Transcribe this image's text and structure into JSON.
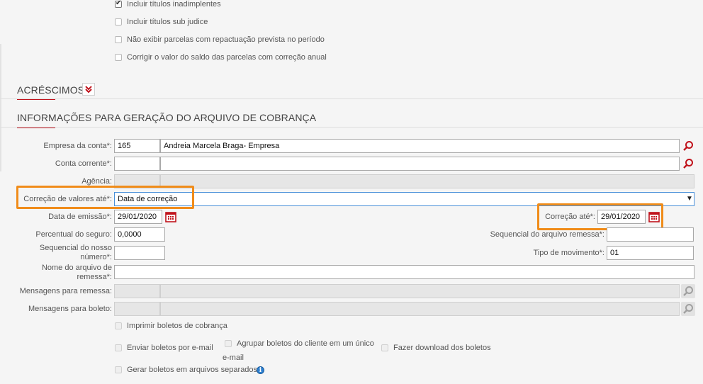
{
  "top_options": [
    {
      "label": "Incluir títulos inadimplentes",
      "checked": true
    },
    {
      "label": "Incluir títulos sub judice",
      "checked": false
    },
    {
      "label": "Não exibir parcelas com repactuação prevista no período",
      "checked": false
    },
    {
      "label": "Corrigir o valor do saldo das parcelas com correção anual",
      "checked": false
    }
  ],
  "sections": {
    "acrescimos": "ACRÉSCIMOS",
    "info": "INFORMAÇÕES PARA GERAÇÃO DO ARQUIVO DE COBRANÇA"
  },
  "form": {
    "empresa": {
      "label": "Empresa da conta*:",
      "code": "165",
      "name": "Andreia Marcela Braga- Empresa"
    },
    "conta": {
      "label": "Conta corrente*:",
      "code": "",
      "name": ""
    },
    "agencia": {
      "label": "Agência:",
      "code": "",
      "name": ""
    },
    "correcao_valores": {
      "label": "Correção de valores até*:",
      "value": "Data de correção"
    },
    "data_emissao": {
      "label": "Data de emissão*:",
      "value": "29/01/2020"
    },
    "correcao_ate": {
      "label": "Correção até*:",
      "value": "29/01/2020"
    },
    "percentual": {
      "label": "Percentual do seguro:",
      "value": "0,0000"
    },
    "seq_remessa": {
      "label": "Sequencial do arquivo remessa*:",
      "value": ""
    },
    "seq_nosso": {
      "label_1": "Sequencial do nosso",
      "label_2": "número*:",
      "value": ""
    },
    "tipo_mov": {
      "label": "Tipo de movimento*:",
      "value": "01"
    },
    "nome_arquivo": {
      "label_1": "Nome do arquivo de",
      "label_2": "remessa*:",
      "value": ""
    },
    "msg_remessa": {
      "label": "Mensagens para remessa:"
    },
    "msg_boleto": {
      "label": "Mensagens para boleto:"
    }
  },
  "bottom_options": {
    "imprimir": "Imprimir boletos de cobrança",
    "enviar": "Enviar boletos por e-mail",
    "agrupar_1": "Agrupar boletos do cliente em um único",
    "agrupar_2": "e-mail",
    "download": "Fazer download dos boletos",
    "separados": "Gerar boletos em arquivos separados"
  },
  "colors": {
    "accent": "#c0121b",
    "highlight": "#f08c1a",
    "info": "#2d7fcf"
  }
}
